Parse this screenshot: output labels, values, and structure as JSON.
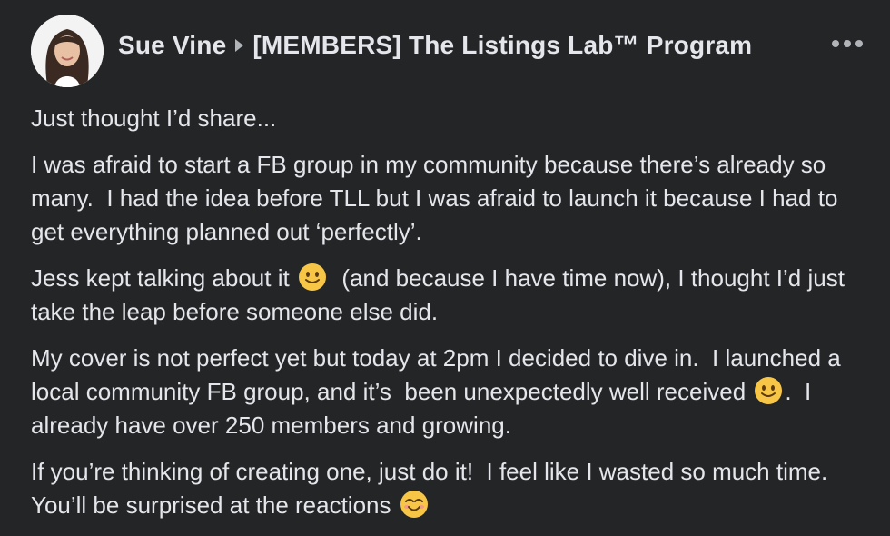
{
  "post": {
    "author": "Sue Vine",
    "group": "[MEMBERS] The Listings Lab™ Program",
    "paragraphs": {
      "p1": "Just thought I’d share...",
      "p2": "I was afraid to start a FB group in my community because there’s already so many.  I had the idea before TLL but I was afraid to launch it because I had to get everything planned out ‘perfectly’.",
      "p3a": "Jess kept talking about it ",
      "p3b": "  (and because I have time now), I thought I’d just take the leap before someone else did.",
      "p4a": "My cover is not perfect yet but today at 2pm I decided to dive in.  I launched a local community FB group, and it’s  been unexpectedly well received ",
      "p4b": ".  I already have over 250 members and growing.",
      "p5a": "If you’re thinking of creating one, just do it!  I feel like I wasted so much time.  You’ll be surprised at the reactions "
    },
    "icons": {
      "more": "more-options-icon",
      "arrow": "group-arrow-icon",
      "emoji1": "slightly-smiling-face-emoji",
      "emoji2": "slightly-smiling-face-emoji",
      "emoji3": "smiling-face-with-smiling-eyes-emoji"
    },
    "colors": {
      "background": "#242526",
      "text": "#e4e6eb",
      "secondary": "#b0b3b8"
    }
  }
}
